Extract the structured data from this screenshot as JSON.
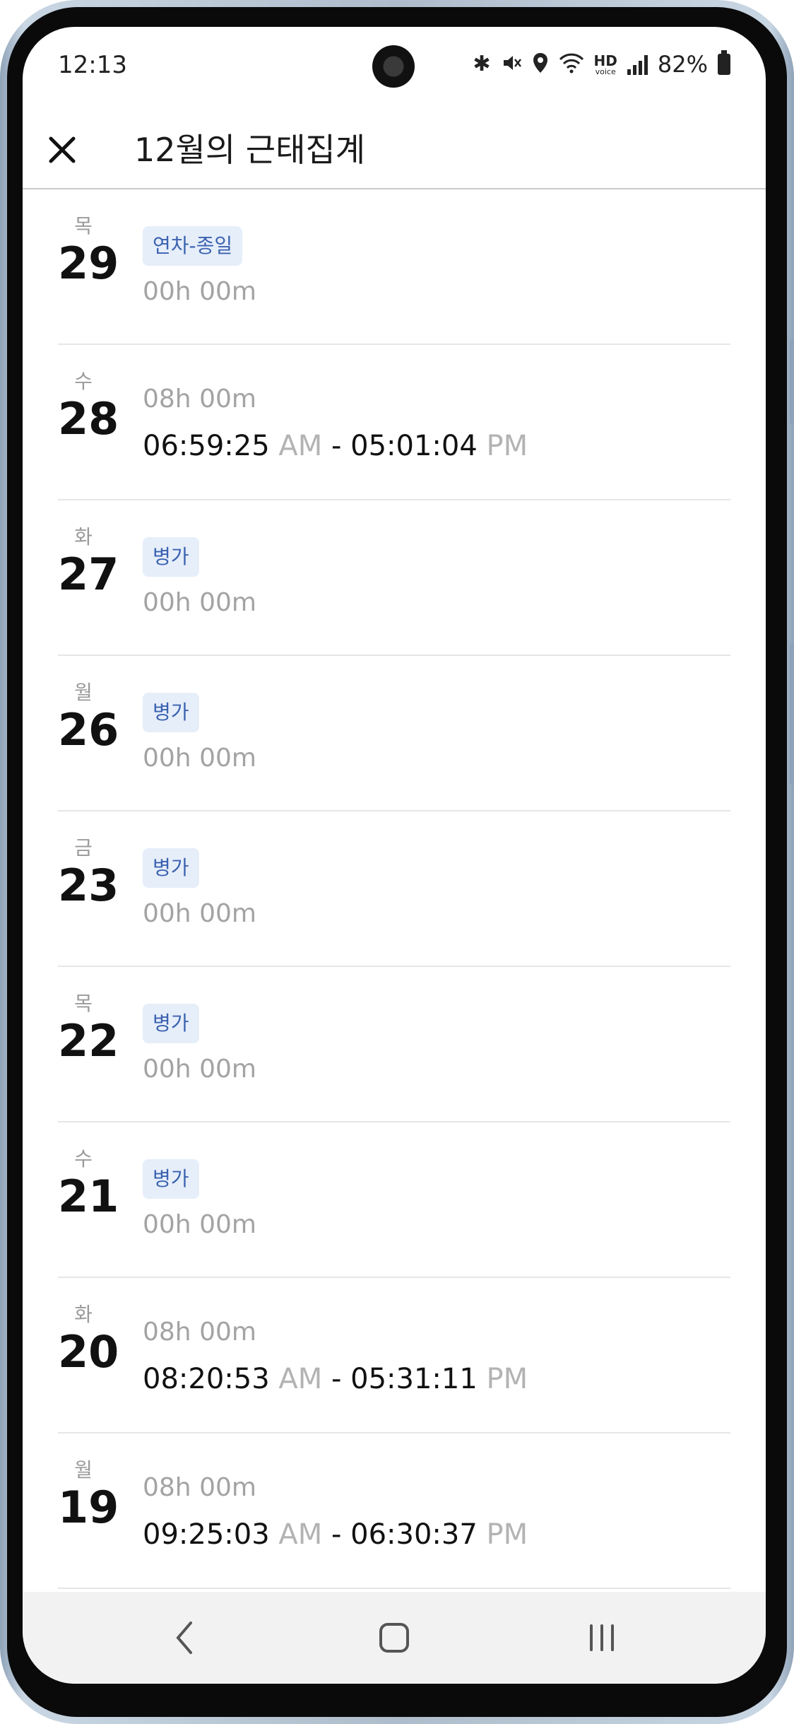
{
  "status_bar": {
    "time": "12:13",
    "battery_percent": "82%",
    "icons": [
      "bluetooth-icon",
      "mute-icon",
      "location-icon",
      "wifi-icon",
      "hd-voice-icon",
      "signal-icon",
      "battery-icon"
    ],
    "hd_label": "HD",
    "voice_label": "voice"
  },
  "header": {
    "title": "12월의 근태집계",
    "close_icon": "close-icon"
  },
  "rows": [
    {
      "dow": "목",
      "day": "29",
      "badge": "연차-종일",
      "duration": "00h 00m"
    },
    {
      "dow": "수",
      "day": "28",
      "duration": "08h 00m",
      "start": "06:59:25",
      "start_ampm": "AM",
      "sep": "-",
      "end": "05:01:04",
      "end_ampm": "PM"
    },
    {
      "dow": "화",
      "day": "27",
      "badge": "병가",
      "duration": "00h 00m"
    },
    {
      "dow": "월",
      "day": "26",
      "badge": "병가",
      "duration": "00h 00m"
    },
    {
      "dow": "금",
      "day": "23",
      "badge": "병가",
      "duration": "00h 00m"
    },
    {
      "dow": "목",
      "day": "22",
      "badge": "병가",
      "duration": "00h 00m"
    },
    {
      "dow": "수",
      "day": "21",
      "badge": "병가",
      "duration": "00h 00m"
    },
    {
      "dow": "화",
      "day": "20",
      "duration": "08h 00m",
      "start": "08:20:53",
      "start_ampm": "AM",
      "sep": "-",
      "end": "05:31:11",
      "end_ampm": "PM"
    },
    {
      "dow": "월",
      "day": "19",
      "duration": "08h 00m",
      "start": "09:25:03",
      "start_ampm": "AM",
      "sep": "-",
      "end": "06:30:37",
      "end_ampm": "PM"
    }
  ],
  "nav_bar": {
    "icons": [
      "back-icon",
      "home-icon",
      "recents-icon"
    ]
  },
  "colors": {
    "badge_bg": "#e6eefa",
    "badge_text": "#3b62b0",
    "muted_text": "#a3a3a3",
    "divider": "#e6e6e6"
  }
}
